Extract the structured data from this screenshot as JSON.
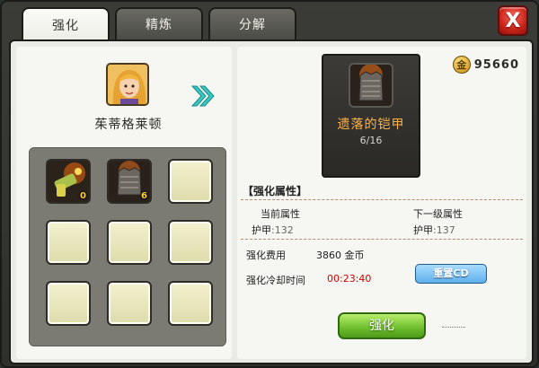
{
  "tabs": [
    {
      "label": "强化",
      "active": true
    },
    {
      "label": "精炼",
      "active": false
    },
    {
      "label": "分解",
      "active": false
    }
  ],
  "close_label": "X",
  "hero": {
    "name": "茱蒂格莱顿"
  },
  "slots": [
    {
      "icon": "weapon-icon",
      "count": "0"
    },
    {
      "icon": "armor-icon",
      "count": "6"
    },
    {
      "icon": "empty-slot",
      "count": ""
    },
    {
      "icon": "empty-slot",
      "count": ""
    },
    {
      "icon": "empty-slot",
      "count": ""
    },
    {
      "icon": "empty-slot",
      "count": ""
    },
    {
      "icon": "empty-slot",
      "count": ""
    },
    {
      "icon": "empty-slot",
      "count": ""
    },
    {
      "icon": "empty-slot",
      "count": ""
    }
  ],
  "gold": {
    "symbol": "金",
    "amount": "95660"
  },
  "item": {
    "name": "遗落的铠甲",
    "level": "6/16"
  },
  "attributes": {
    "section_title": "【强化属性】",
    "current_header": "当前属性",
    "next_header": "下一级属性",
    "current_label": "护甲",
    "current_value": ":132",
    "next_label": "护甲",
    "next_value": ":137"
  },
  "cost": {
    "label": "强化费用",
    "amount": "3860",
    "unit": "金币"
  },
  "cooldown": {
    "label": "强化冷却时间",
    "time": "00:23:40"
  },
  "buttons": {
    "reset_cd": "重置CD",
    "enhance": "强化"
  },
  "colors": {
    "accent_green": "#6dbd2c",
    "timer_red": "#d40000",
    "item_orange": "#ffb347"
  }
}
